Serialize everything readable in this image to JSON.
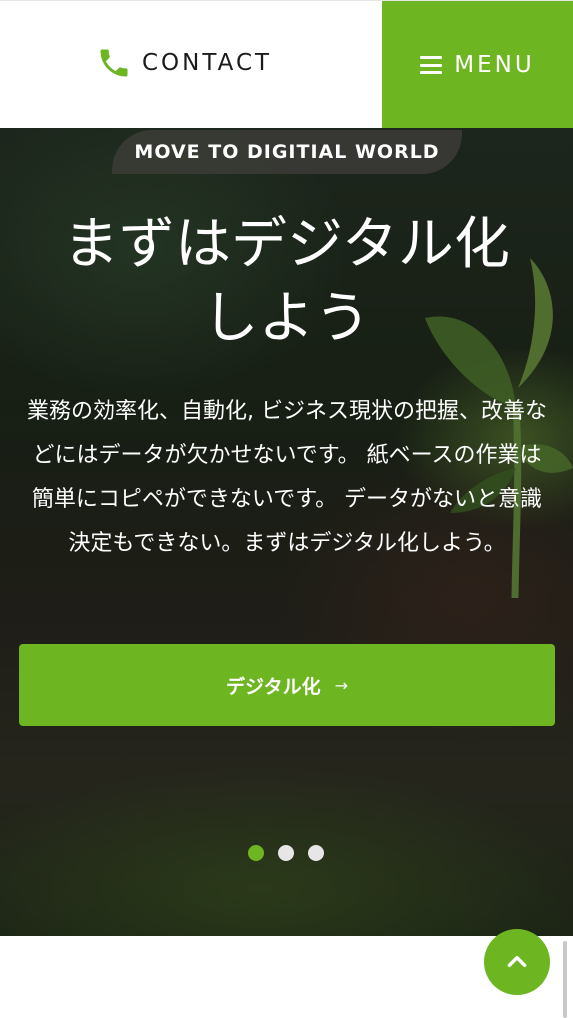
{
  "header": {
    "contact_label": "CONTACT",
    "contact_icon": "phone-icon",
    "menu_label": "MENU",
    "menu_icon": "hamburger-icon"
  },
  "hero": {
    "tag": "MOVE TO DIGITIAL WORLD",
    "headline_line1": "まずはデジタル化",
    "headline_line2": "しよう",
    "body": "業務の効率化、自動化, ビジネス現状の把握、改善などにはデータが欠かせないです。 紙ベースの作業は簡単にコピペができないです。 データがないと意識決定もできない。まずはデジタル化しよう。",
    "cta_label": "デジタル化",
    "cta_arrow": "→",
    "slides": {
      "count": 3,
      "active_index": 0
    }
  },
  "scroll_top": {
    "icon": "chevron-up-icon"
  },
  "colors": {
    "accent": "#6db521",
    "header_bg": "#ffffff",
    "text_dark": "#1b1b1b",
    "dot_inactive": "#e6e6e6"
  }
}
